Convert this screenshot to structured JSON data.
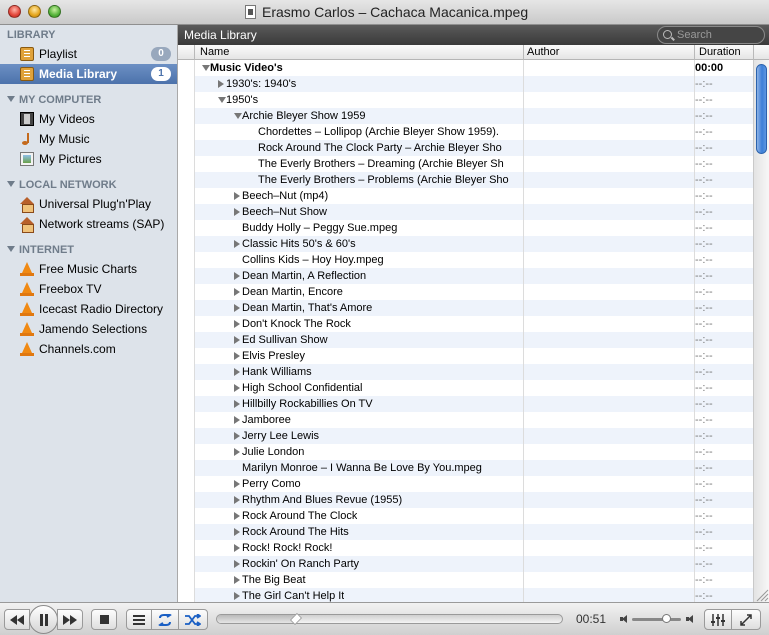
{
  "window": {
    "title": "Erasmo Carlos – Cachaca Macanica.mpeg"
  },
  "sidebar": {
    "sections": [
      {
        "title": "LIBRARY",
        "items": [
          {
            "label": "Playlist",
            "icon": "playlist-icon",
            "badge": "0",
            "selected": false
          },
          {
            "label": "Media Library",
            "icon": "media-library-icon",
            "badge": "1",
            "selected": true
          }
        ]
      },
      {
        "title": "MY COMPUTER",
        "items": [
          {
            "label": "My Videos",
            "icon": "film-icon"
          },
          {
            "label": "My Music",
            "icon": "music-note-icon"
          },
          {
            "label": "My Pictures",
            "icon": "picture-icon"
          }
        ]
      },
      {
        "title": "LOCAL NETWORK",
        "items": [
          {
            "label": "Universal Plug'n'Play",
            "icon": "house-icon"
          },
          {
            "label": "Network streams (SAP)",
            "icon": "house-icon"
          }
        ]
      },
      {
        "title": "INTERNET",
        "items": [
          {
            "label": "Free Music Charts",
            "icon": "vlc-cone-icon"
          },
          {
            "label": "Freebox TV",
            "icon": "vlc-cone-icon"
          },
          {
            "label": "Icecast Radio Directory",
            "icon": "vlc-cone-icon"
          },
          {
            "label": "Jamendo Selections",
            "icon": "vlc-cone-icon"
          },
          {
            "label": "Channels.com",
            "icon": "vlc-cone-icon"
          }
        ]
      }
    ]
  },
  "main": {
    "title": "Media Library",
    "search_placeholder": "Search",
    "columns": [
      "Name",
      "Author",
      "Duration"
    ],
    "rows": [
      {
        "name": "Music Video's",
        "level": 0,
        "toggle": "down",
        "bold": true,
        "duration": "00:00"
      },
      {
        "name": "1930's: 1940's",
        "level": 1,
        "toggle": "right",
        "duration": "--:--"
      },
      {
        "name": "1950's",
        "level": 1,
        "toggle": "down",
        "duration": "--:--"
      },
      {
        "name": "Archie Bleyer Show 1959",
        "level": 2,
        "toggle": "down",
        "duration": "--:--"
      },
      {
        "name": "Chordettes – Lollipop (Archie Bleyer Show 1959).",
        "level": 3,
        "toggle": "none",
        "duration": "--:--"
      },
      {
        "name": "Rock Around The Clock Party – Archie Bleyer Sho",
        "level": 3,
        "toggle": "none",
        "duration": "--:--"
      },
      {
        "name": "The Everly Brothers – Dreaming (Archie Bleyer Sh",
        "level": 3,
        "toggle": "none",
        "duration": "--:--"
      },
      {
        "name": "The Everly Brothers – Problems (Archie Bleyer Sho",
        "level": 3,
        "toggle": "none",
        "duration": "--:--"
      },
      {
        "name": "Beech–Nut (mp4)",
        "level": 2,
        "toggle": "right",
        "duration": "--:--"
      },
      {
        "name": "Beech–Nut Show",
        "level": 2,
        "toggle": "right",
        "duration": "--:--"
      },
      {
        "name": "Buddy Holly – Peggy Sue.mpeg",
        "level": 2,
        "toggle": "none",
        "duration": "--:--"
      },
      {
        "name": "Classic Hits 50's & 60's",
        "level": 2,
        "toggle": "right",
        "duration": "--:--"
      },
      {
        "name": "Collins Kids – Hoy Hoy.mpeg",
        "level": 2,
        "toggle": "none",
        "duration": "--:--"
      },
      {
        "name": "Dean Martin, A Reflection",
        "level": 2,
        "toggle": "right",
        "duration": "--:--"
      },
      {
        "name": "Dean Martin, Encore",
        "level": 2,
        "toggle": "right",
        "duration": "--:--"
      },
      {
        "name": "Dean Martin, That's Amore",
        "level": 2,
        "toggle": "right",
        "duration": "--:--"
      },
      {
        "name": "Don't Knock The Rock",
        "level": 2,
        "toggle": "right",
        "duration": "--:--"
      },
      {
        "name": "Ed Sullivan Show",
        "level": 2,
        "toggle": "right",
        "duration": "--:--"
      },
      {
        "name": "Elvis Presley",
        "level": 2,
        "toggle": "right",
        "duration": "--:--"
      },
      {
        "name": "Hank Williams",
        "level": 2,
        "toggle": "right",
        "duration": "--:--"
      },
      {
        "name": "High School Confidential",
        "level": 2,
        "toggle": "right",
        "duration": "--:--"
      },
      {
        "name": "Hillbilly Rockabillies On TV",
        "level": 2,
        "toggle": "right",
        "duration": "--:--"
      },
      {
        "name": "Jamboree",
        "level": 2,
        "toggle": "right",
        "duration": "--:--"
      },
      {
        "name": "Jerry Lee Lewis",
        "level": 2,
        "toggle": "right",
        "duration": "--:--"
      },
      {
        "name": "Julie London",
        "level": 2,
        "toggle": "right",
        "duration": "--:--"
      },
      {
        "name": "Marilyn Monroe – I Wanna Be Love By You.mpeg",
        "level": 2,
        "toggle": "none",
        "duration": "--:--"
      },
      {
        "name": "Perry Como",
        "level": 2,
        "toggle": "right",
        "duration": "--:--"
      },
      {
        "name": "Rhythm And Blues Revue (1955)",
        "level": 2,
        "toggle": "right",
        "duration": "--:--"
      },
      {
        "name": "Rock Around The Clock",
        "level": 2,
        "toggle": "right",
        "duration": "--:--"
      },
      {
        "name": "Rock Around The Hits",
        "level": 2,
        "toggle": "right",
        "duration": "--:--"
      },
      {
        "name": "Rock! Rock! Rock!",
        "level": 2,
        "toggle": "right",
        "duration": "--:--"
      },
      {
        "name": "Rockin' On Ranch Party",
        "level": 2,
        "toggle": "right",
        "duration": "--:--"
      },
      {
        "name": "The Big Beat",
        "level": 2,
        "toggle": "right",
        "duration": "--:--"
      },
      {
        "name": "The Girl Can't Help It",
        "level": 2,
        "toggle": "right",
        "duration": "--:--"
      }
    ]
  },
  "player": {
    "elapsed": "00:51",
    "progress_fraction": 0.23,
    "volume_fraction": 0.7
  },
  "colors": {
    "selection": "#4c72ab",
    "sidebar_bg": "#dde3ea",
    "header_dark": "#3a3a3a",
    "scroll_thumb": "#3c7fd8",
    "toolbar_accent": "#1a5fc4"
  }
}
